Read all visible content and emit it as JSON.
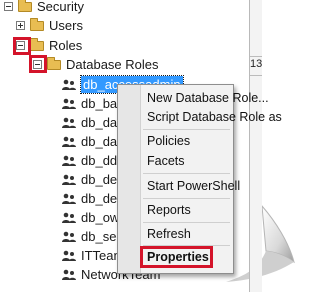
{
  "tree": {
    "security": "Security",
    "users": "Users",
    "roles": "Roles",
    "database_roles": "Database Roles",
    "role_items": [
      "db_accessadmin",
      "db_ba",
      "db_da",
      "db_da",
      "db_dd",
      "db_de",
      "db_de",
      "db_ow",
      "db_sec",
      "ITTean",
      "NetworkTeam"
    ],
    "right_column_value": "13"
  },
  "context_menu": {
    "items": [
      "New Database Role...",
      "Script Database Role as",
      "Policies",
      "Facets",
      "Start PowerShell",
      "Reports",
      "Refresh",
      "Properties"
    ]
  },
  "colors": {
    "highlight": "#d4142a",
    "selection": "#3399ff"
  }
}
